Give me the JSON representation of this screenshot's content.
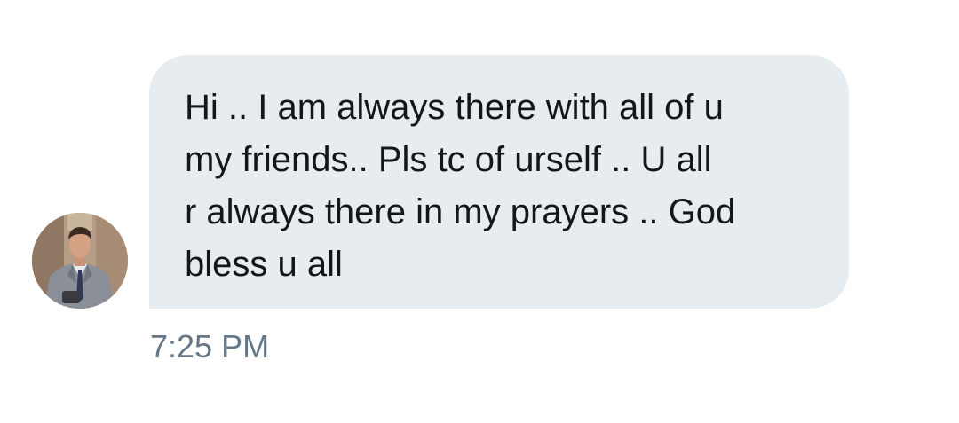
{
  "message": {
    "text": "Hi .. I am always there with all of u\nmy friends.. Pls tc of urself .. U all\nr always there in my prayers .. God\nbless u all",
    "timestamp": "7:25 PM",
    "bubble_color": "#e6ecf0",
    "text_color": "#14171a",
    "timestamp_color": "#657786"
  },
  "sender": {
    "avatar_icon": "user-avatar-photo"
  }
}
